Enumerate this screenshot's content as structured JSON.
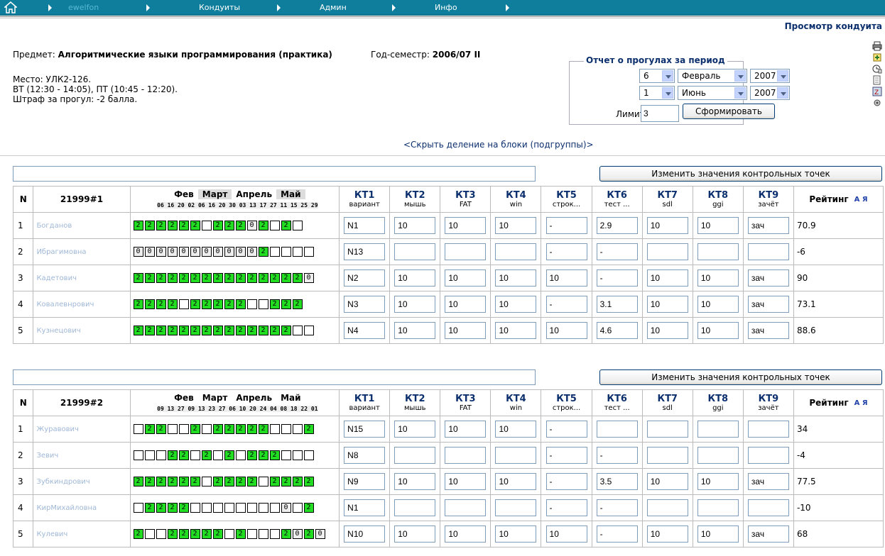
{
  "nav": {
    "items": [
      "ewelfon",
      "Кондуиты",
      "Админ",
      "Инфо"
    ]
  },
  "view_title": "Просмотр кондуита",
  "subject": {
    "label": "Предмет:",
    "value": "Алгоритмические языки программирования (практика)"
  },
  "semester": {
    "label": "Год-семестр:",
    "value": "2006/07 II"
  },
  "place": "Место: УЛК2-126.",
  "schedule": "ВТ (12:30 - 14:05), ПТ (10:45 - 12:20).",
  "penalty": "Штраф за прогул: -2 балла.",
  "report": {
    "legend": "Отчет о прогулах за период",
    "from_day": "6",
    "from_month": "Февраль",
    "from_year": "2007",
    "to_day": "1",
    "to_month": "Июнь",
    "to_year": "2007",
    "limit_label": "Лимит:",
    "limit_value": "3",
    "button": "Сформировать"
  },
  "hide_link": "<Скрыть деление на блоки (подгруппы)>",
  "change_button": "Изменить значения контрольных точек",
  "kt_headers": [
    {
      "kt": "КТ1",
      "sub": "вариант"
    },
    {
      "kt": "КТ2",
      "sub": "мышь"
    },
    {
      "kt": "КТ3",
      "sub": "FAT"
    },
    {
      "kt": "КТ4",
      "sub": "win"
    },
    {
      "kt": "КТ5",
      "sub": "строк..."
    },
    {
      "kt": "КТ6",
      "sub": "тест ..."
    },
    {
      "kt": "КТ7",
      "sub": "sdl"
    },
    {
      "kt": "КТ8",
      "sub": "ggi"
    },
    {
      "kt": "КТ9",
      "sub": "зачёт"
    }
  ],
  "col_n": "N",
  "col_rating": "Рейтинг",
  "sort_icon": "А Я",
  "groups": [
    {
      "name": "21999#1",
      "months": [
        "Фев",
        "Март",
        "Апрель",
        "Май"
      ],
      "days": "06 16 20 02 06 16 20 30 03 13 17 27 11 15 25 29",
      "rows": [
        {
          "n": "1",
          "name": "Богданов",
          "boxes": [
            "2",
            "2",
            "2",
            "2",
            "2",
            "2",
            "",
            "2",
            "2",
            "2",
            "0",
            "2",
            "",
            "2",
            ""
          ],
          "kt": [
            "N1",
            "10",
            "10",
            "10",
            "-",
            "2.9",
            "10",
            "10",
            "зач"
          ],
          "rating": "70.9"
        },
        {
          "n": "2",
          "name": "Ибрагимовна",
          "boxes": [
            "0",
            "0",
            "0",
            "0",
            "0",
            "0",
            "0",
            "0",
            "0",
            "0",
            "0",
            "2",
            "",
            "",
            "",
            ""
          ],
          "kt": [
            "N13",
            "",
            "",
            "",
            "-",
            "-",
            "",
            "",
            ""
          ],
          "rating": "-6"
        },
        {
          "n": "3",
          "name": "Кадетович",
          "boxes": [
            "2",
            "2",
            "2",
            "2",
            "2",
            "2",
            "2",
            "2",
            "2",
            "2",
            "2",
            "2",
            "2",
            "2",
            "2",
            "0"
          ],
          "kt": [
            "N2",
            "10",
            "10",
            "10",
            "10",
            "-",
            "10",
            "10",
            "зач"
          ],
          "rating": "90"
        },
        {
          "n": "4",
          "name": "Ковалевнрович",
          "boxes": [
            "2",
            "2",
            "2",
            "2",
            "",
            "2",
            "2",
            "2",
            "2",
            "2",
            "",
            "",
            "2",
            "2",
            "2"
          ],
          "kt": [
            "N3",
            "10",
            "10",
            "10",
            "-",
            "3.1",
            "10",
            "10",
            "зач"
          ],
          "rating": "73.1"
        },
        {
          "n": "5",
          "name": "Кузнецович",
          "boxes": [
            "2",
            "2",
            "2",
            "2",
            "2",
            "2",
            "2",
            "2",
            "2",
            "2",
            "2",
            "2",
            "2",
            "2",
            "",
            ""
          ],
          "kt": [
            "N4",
            "10",
            "10",
            "10",
            "10",
            "4.6",
            "10",
            "10",
            "зач"
          ],
          "rating": "88.6"
        }
      ]
    },
    {
      "name": "21999#2",
      "months": [
        "Фев",
        "Март",
        "Апрель",
        "Май"
      ],
      "days": "09 13 27 09 13 23 27 06 10 20 24 04 08 18 22 01",
      "rows": [
        {
          "n": "1",
          "name": "Журавович",
          "boxes": [
            "",
            "2",
            "2",
            "",
            "",
            "2",
            "",
            "2",
            "2",
            "2",
            "2",
            "2",
            "",
            "",
            "",
            "2"
          ],
          "kt": [
            "N15",
            "10",
            "10",
            "10",
            "-",
            "",
            "",
            "",
            ""
          ],
          "rating": "34"
        },
        {
          "n": "2",
          "name": "Зевич",
          "boxes": [
            "",
            "",
            "",
            "2",
            "2",
            "",
            "2",
            "",
            "2",
            "",
            "2",
            "2",
            "2",
            "",
            "",
            ""
          ],
          "kt": [
            "N8",
            "",
            "",
            "",
            "-",
            "-",
            "",
            "",
            ""
          ],
          "rating": "-4"
        },
        {
          "n": "3",
          "name": "Зубкиндрович",
          "boxes": [
            "2",
            "2",
            "2",
            "2",
            "2",
            "2",
            "",
            "2",
            "2",
            "2",
            "2",
            "",
            "2",
            "2",
            "2",
            "2"
          ],
          "kt": [
            "N9",
            "10",
            "10",
            "10",
            "-",
            "3.5",
            "10",
            "10",
            "зач"
          ],
          "rating": "77.5"
        },
        {
          "n": "4",
          "name": "КирМихайловна",
          "boxes": [
            "",
            "2",
            "2",
            "2",
            "2",
            "",
            "",
            "",
            "",
            "",
            "",
            "",
            "",
            "0",
            "",
            "2"
          ],
          "kt": [
            "N1",
            "",
            "",
            "",
            "-",
            "-",
            "",
            "",
            ""
          ],
          "rating": "-10"
        },
        {
          "n": "5",
          "name": "Кулевич",
          "boxes": [
            "2",
            "",
            "",
            "2",
            "2",
            "2",
            "2",
            "2",
            "",
            "2",
            "",
            "",
            "",
            "2",
            "0",
            "2",
            "0"
          ],
          "kt": [
            "N10",
            "10",
            "10",
            "10",
            "10",
            "-",
            "10",
            "10",
            "зач"
          ],
          "rating": "68"
        }
      ]
    }
  ]
}
